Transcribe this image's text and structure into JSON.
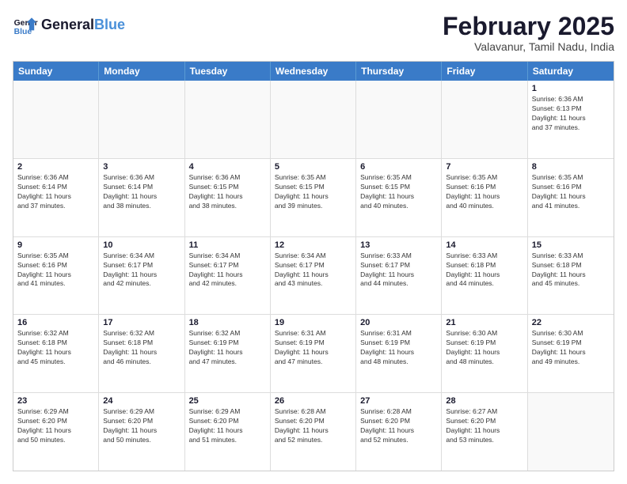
{
  "header": {
    "logo_line1": "General",
    "logo_line2": "Blue",
    "month": "February 2025",
    "location": "Valavanur, Tamil Nadu, India"
  },
  "weekdays": [
    "Sunday",
    "Monday",
    "Tuesday",
    "Wednesday",
    "Thursday",
    "Friday",
    "Saturday"
  ],
  "weeks": [
    [
      {
        "day": "",
        "info": ""
      },
      {
        "day": "",
        "info": ""
      },
      {
        "day": "",
        "info": ""
      },
      {
        "day": "",
        "info": ""
      },
      {
        "day": "",
        "info": ""
      },
      {
        "day": "",
        "info": ""
      },
      {
        "day": "1",
        "info": "Sunrise: 6:36 AM\nSunset: 6:13 PM\nDaylight: 11 hours\nand 37 minutes."
      }
    ],
    [
      {
        "day": "2",
        "info": "Sunrise: 6:36 AM\nSunset: 6:14 PM\nDaylight: 11 hours\nand 37 minutes."
      },
      {
        "day": "3",
        "info": "Sunrise: 6:36 AM\nSunset: 6:14 PM\nDaylight: 11 hours\nand 38 minutes."
      },
      {
        "day": "4",
        "info": "Sunrise: 6:36 AM\nSunset: 6:15 PM\nDaylight: 11 hours\nand 38 minutes."
      },
      {
        "day": "5",
        "info": "Sunrise: 6:35 AM\nSunset: 6:15 PM\nDaylight: 11 hours\nand 39 minutes."
      },
      {
        "day": "6",
        "info": "Sunrise: 6:35 AM\nSunset: 6:15 PM\nDaylight: 11 hours\nand 40 minutes."
      },
      {
        "day": "7",
        "info": "Sunrise: 6:35 AM\nSunset: 6:16 PM\nDaylight: 11 hours\nand 40 minutes."
      },
      {
        "day": "8",
        "info": "Sunrise: 6:35 AM\nSunset: 6:16 PM\nDaylight: 11 hours\nand 41 minutes."
      }
    ],
    [
      {
        "day": "9",
        "info": "Sunrise: 6:35 AM\nSunset: 6:16 PM\nDaylight: 11 hours\nand 41 minutes."
      },
      {
        "day": "10",
        "info": "Sunrise: 6:34 AM\nSunset: 6:17 PM\nDaylight: 11 hours\nand 42 minutes."
      },
      {
        "day": "11",
        "info": "Sunrise: 6:34 AM\nSunset: 6:17 PM\nDaylight: 11 hours\nand 42 minutes."
      },
      {
        "day": "12",
        "info": "Sunrise: 6:34 AM\nSunset: 6:17 PM\nDaylight: 11 hours\nand 43 minutes."
      },
      {
        "day": "13",
        "info": "Sunrise: 6:33 AM\nSunset: 6:17 PM\nDaylight: 11 hours\nand 44 minutes."
      },
      {
        "day": "14",
        "info": "Sunrise: 6:33 AM\nSunset: 6:18 PM\nDaylight: 11 hours\nand 44 minutes."
      },
      {
        "day": "15",
        "info": "Sunrise: 6:33 AM\nSunset: 6:18 PM\nDaylight: 11 hours\nand 45 minutes."
      }
    ],
    [
      {
        "day": "16",
        "info": "Sunrise: 6:32 AM\nSunset: 6:18 PM\nDaylight: 11 hours\nand 45 minutes."
      },
      {
        "day": "17",
        "info": "Sunrise: 6:32 AM\nSunset: 6:18 PM\nDaylight: 11 hours\nand 46 minutes."
      },
      {
        "day": "18",
        "info": "Sunrise: 6:32 AM\nSunset: 6:19 PM\nDaylight: 11 hours\nand 47 minutes."
      },
      {
        "day": "19",
        "info": "Sunrise: 6:31 AM\nSunset: 6:19 PM\nDaylight: 11 hours\nand 47 minutes."
      },
      {
        "day": "20",
        "info": "Sunrise: 6:31 AM\nSunset: 6:19 PM\nDaylight: 11 hours\nand 48 minutes."
      },
      {
        "day": "21",
        "info": "Sunrise: 6:30 AM\nSunset: 6:19 PM\nDaylight: 11 hours\nand 48 minutes."
      },
      {
        "day": "22",
        "info": "Sunrise: 6:30 AM\nSunset: 6:19 PM\nDaylight: 11 hours\nand 49 minutes."
      }
    ],
    [
      {
        "day": "23",
        "info": "Sunrise: 6:29 AM\nSunset: 6:20 PM\nDaylight: 11 hours\nand 50 minutes."
      },
      {
        "day": "24",
        "info": "Sunrise: 6:29 AM\nSunset: 6:20 PM\nDaylight: 11 hours\nand 50 minutes."
      },
      {
        "day": "25",
        "info": "Sunrise: 6:29 AM\nSunset: 6:20 PM\nDaylight: 11 hours\nand 51 minutes."
      },
      {
        "day": "26",
        "info": "Sunrise: 6:28 AM\nSunset: 6:20 PM\nDaylight: 11 hours\nand 52 minutes."
      },
      {
        "day": "27",
        "info": "Sunrise: 6:28 AM\nSunset: 6:20 PM\nDaylight: 11 hours\nand 52 minutes."
      },
      {
        "day": "28",
        "info": "Sunrise: 6:27 AM\nSunset: 6:20 PM\nDaylight: 11 hours\nand 53 minutes."
      },
      {
        "day": "",
        "info": ""
      }
    ]
  ]
}
